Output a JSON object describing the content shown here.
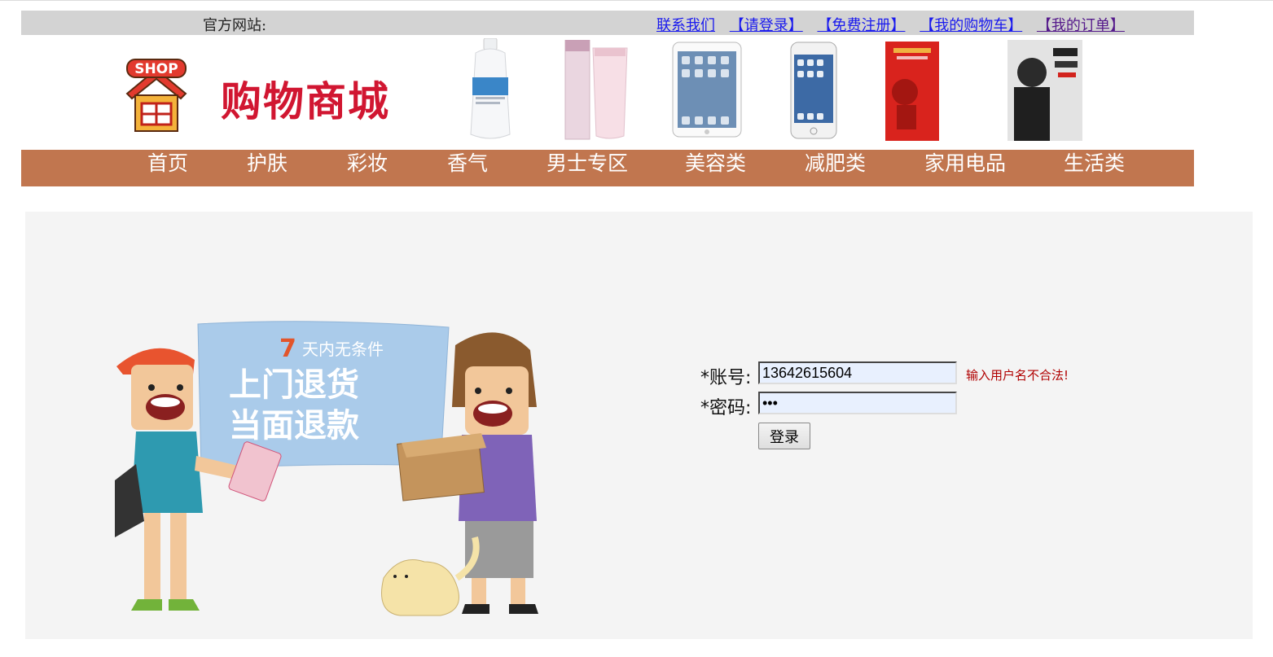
{
  "topbar": {
    "site_label": "官方网站:",
    "links": [
      "联系我们",
      "【请登录】",
      "【免费注册】",
      "【我的购物车】",
      "【我的订单】"
    ]
  },
  "header": {
    "logo_badge": "SHOP",
    "logo_text": "购物商城"
  },
  "nav": {
    "items": [
      "首页",
      "护肤",
      "彩妆",
      "香气",
      "男士专区",
      "美容类",
      "减肥类",
      "家用电品",
      "生活类"
    ]
  },
  "promo": {
    "days": "7",
    "line1": "天内无条件",
    "line2": "上门退货",
    "line3": "当面退款"
  },
  "login": {
    "account_label": "*账号:",
    "account_value": "13642615604",
    "account_error": "输入用户名不合法!",
    "password_label": "*密码:",
    "password_value": "...",
    "submit_label": "登录"
  },
  "colors": {
    "nav_bg": "#c1764f",
    "topbar_bg": "#d3d3d3",
    "logo_red": "#d11631",
    "error_red": "#b00000",
    "input_autofill": "#e8f0fe"
  }
}
